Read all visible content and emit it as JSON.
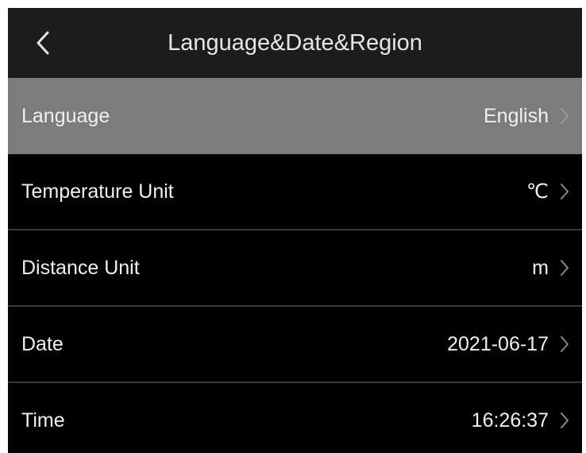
{
  "header": {
    "title": "Language&Date&Region",
    "back_icon": "chevron-left-icon"
  },
  "colors": {
    "header_bg": "#1c1c1c",
    "body_bg": "#000000",
    "selected_row_bg": "#7c7c7c",
    "divider": "#3a3a3a",
    "text": "#f0f0f0",
    "chevron": "#8a8a8a"
  },
  "settings": {
    "items": [
      {
        "label": "Language",
        "value": "English",
        "icon": "chevron-right-icon",
        "selected": true
      },
      {
        "label": "Temperature Unit",
        "value": "℃",
        "icon": "chevron-right-icon",
        "selected": false
      },
      {
        "label": "Distance Unit",
        "value": "m",
        "icon": "chevron-right-icon",
        "selected": false
      },
      {
        "label": "Date",
        "value": "2021-06-17",
        "icon": "chevron-right-icon",
        "selected": false
      },
      {
        "label": "Time",
        "value": "16:26:37",
        "icon": "chevron-right-icon",
        "selected": false
      }
    ]
  }
}
